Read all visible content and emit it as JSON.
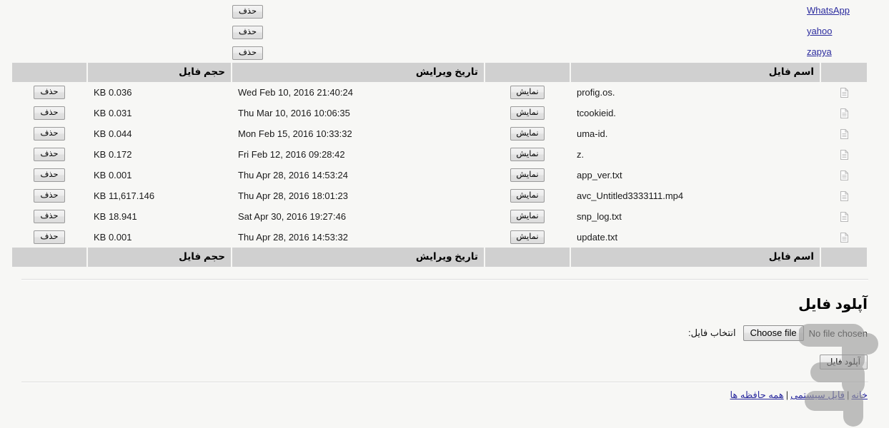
{
  "top_partial_rows": {
    "delete_labels": [
      "حذف",
      "حذف",
      "حذف"
    ],
    "links": [
      {
        "label": "WhatsApp"
      },
      {
        "label": "yahoo"
      },
      {
        "label": "zapya"
      }
    ]
  },
  "table": {
    "headers": {
      "icon": "",
      "name": "اسم فایل",
      "view": "",
      "date": "تاریخ ویرایش",
      "size": "حجم فایل",
      "delete": ""
    },
    "buttons": {
      "view_label": "نمایش",
      "delete_label": "حذف"
    },
    "rows": [
      {
        "name": "profig.os.",
        "date": "Wed Feb 10, 2016 21:40:24",
        "size": "KB 0.036"
      },
      {
        "name": "tcookieid.",
        "date": "Thu Mar 10, 2016 10:06:35",
        "size": "KB 0.031"
      },
      {
        "name": "uma-id.",
        "date": "Mon Feb 15, 2016 10:33:32",
        "size": "KB 0.044"
      },
      {
        "name": "z.",
        "date": "Fri Feb 12, 2016 09:28:42",
        "size": "KB 0.172"
      },
      {
        "name": "app_ver.txt",
        "date": "Thu Apr 28, 2016 14:53:24",
        "size": "KB 0.001"
      },
      {
        "name": "avc_Untitled3333111.mp4",
        "date": "Thu Apr 28, 2016 18:01:23",
        "size": "KB 11,617.146"
      },
      {
        "name": "snp_log.txt",
        "date": "Sat Apr 30, 2016 19:27:46",
        "size": "KB 18.941"
      },
      {
        "name": "update.txt",
        "date": "Thu Apr 28, 2016 14:53:32",
        "size": "KB 0.001"
      }
    ]
  },
  "upload": {
    "title": "آپلود فایل",
    "field_label": "انتخاب فایل:",
    "choose_button": "Choose file",
    "no_file_text": "No file chosen",
    "submit_label": "آپلود فایل"
  },
  "footer": {
    "links": [
      {
        "label": "خانه"
      },
      {
        "label": "فایل سیستمی"
      },
      {
        "label": "همه حافظه ها"
      }
    ],
    "separator": "|"
  },
  "colors": {
    "page_background": "#f7f7f5",
    "header_row": "#d0d0d0",
    "link": "#2b2b9e",
    "text": "#111111",
    "watermark": "#9a9a9a"
  }
}
